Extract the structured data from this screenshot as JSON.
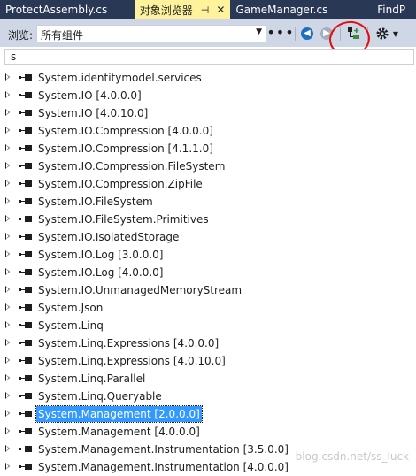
{
  "tabs": [
    {
      "label": "ProtectAssembly.cs",
      "active": false
    },
    {
      "label": "对象浏览器",
      "active": true,
      "pin": "⊣",
      "close": "✕"
    },
    {
      "label": "GameManager.cs",
      "active": false
    },
    {
      "label": "FindP",
      "active": false
    }
  ],
  "toolbar": {
    "browse_label": "浏览:",
    "scope_value": "所有组件",
    "more_label": "•••"
  },
  "search": {
    "value": "s"
  },
  "tree": [
    "System.identitymodel.services",
    "System.IO [4.0.0.0]",
    "System.IO [4.0.10.0]",
    "System.IO.Compression [4.0.0.0]",
    "System.IO.Compression [4.1.1.0]",
    "System.IO.Compression.FileSystem",
    "System.IO.Compression.ZipFile",
    "System.IO.FileSystem",
    "System.IO.FileSystem.Primitives",
    "System.IO.IsolatedStorage",
    "System.IO.Log [3.0.0.0]",
    "System.IO.Log [4.0.0.0]",
    "System.IO.UnmanagedMemoryStream",
    "System.Json",
    "System.Linq",
    "System.Linq.Expressions [4.0.0.0]",
    "System.Linq.Expressions [4.0.10.0]",
    "System.Linq.Parallel",
    "System.Linq.Queryable",
    "System.Management [2.0.0.0]",
    "System.Management [4.0.0.0]",
    "System.Management.Instrumentation [3.5.0.0]",
    "System.Management.Instrumentation [4.0.0.0]"
  ],
  "selected_index": 19,
  "watermark": "blog.csdn.net/ss_luck"
}
